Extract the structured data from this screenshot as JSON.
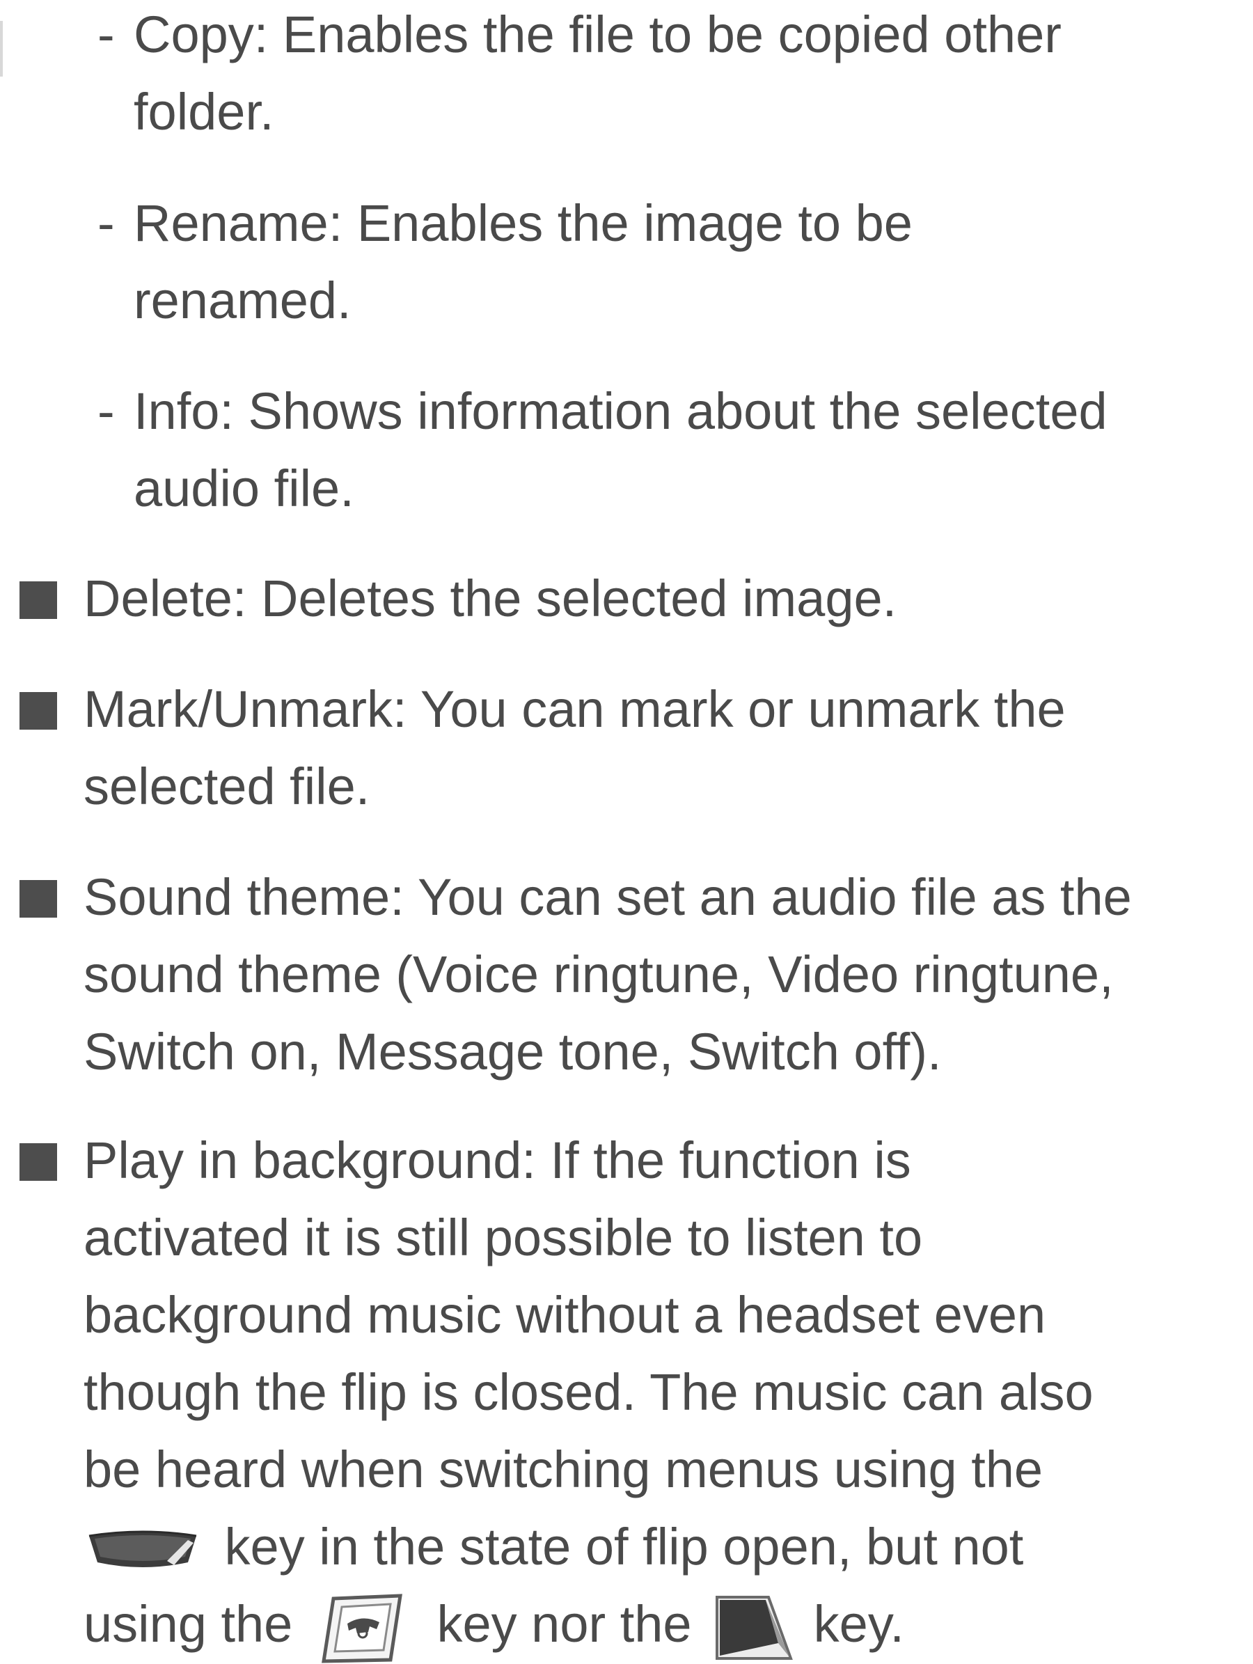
{
  "sub_items": [
    {
      "dash": "-",
      "lines": [
        "Copy: Enables the file to be copied other",
        "folder."
      ]
    },
    {
      "dash": "-",
      "lines": [
        "Rename: Enables the image to be",
        "renamed."
      ]
    },
    {
      "dash": "-",
      "lines": [
        "Info: Shows information about the selected",
        "audio file."
      ]
    }
  ],
  "bullets": [
    {
      "lines": [
        "Delete: Deletes the selected image."
      ]
    },
    {
      "lines": [
        "Mark/Unmark: You can mark or unmark the",
        "selected file."
      ]
    },
    {
      "lines": [
        "Sound theme: You can set an audio file as the",
        "sound theme (Voice ringtune, Video ringtune,",
        "Switch on, Message tone, Switch off)."
      ]
    }
  ],
  "play_bullet": {
    "lines": [
      "Play in background: If the function is",
      "activated it is still possible to listen to",
      "background music without a headset even",
      "though the flip is closed. The music can also",
      "be heard when switching menus using the"
    ],
    "line6_after_key": " key in the state of flip open, but not",
    "line7_prefix": "using the ",
    "line7_mid": " key nor the ",
    "line7_suffix": " key."
  },
  "icons": {
    "menu_key": "menu-key-icon",
    "call_key": "call-key-icon",
    "end_key": "end-key-icon"
  }
}
